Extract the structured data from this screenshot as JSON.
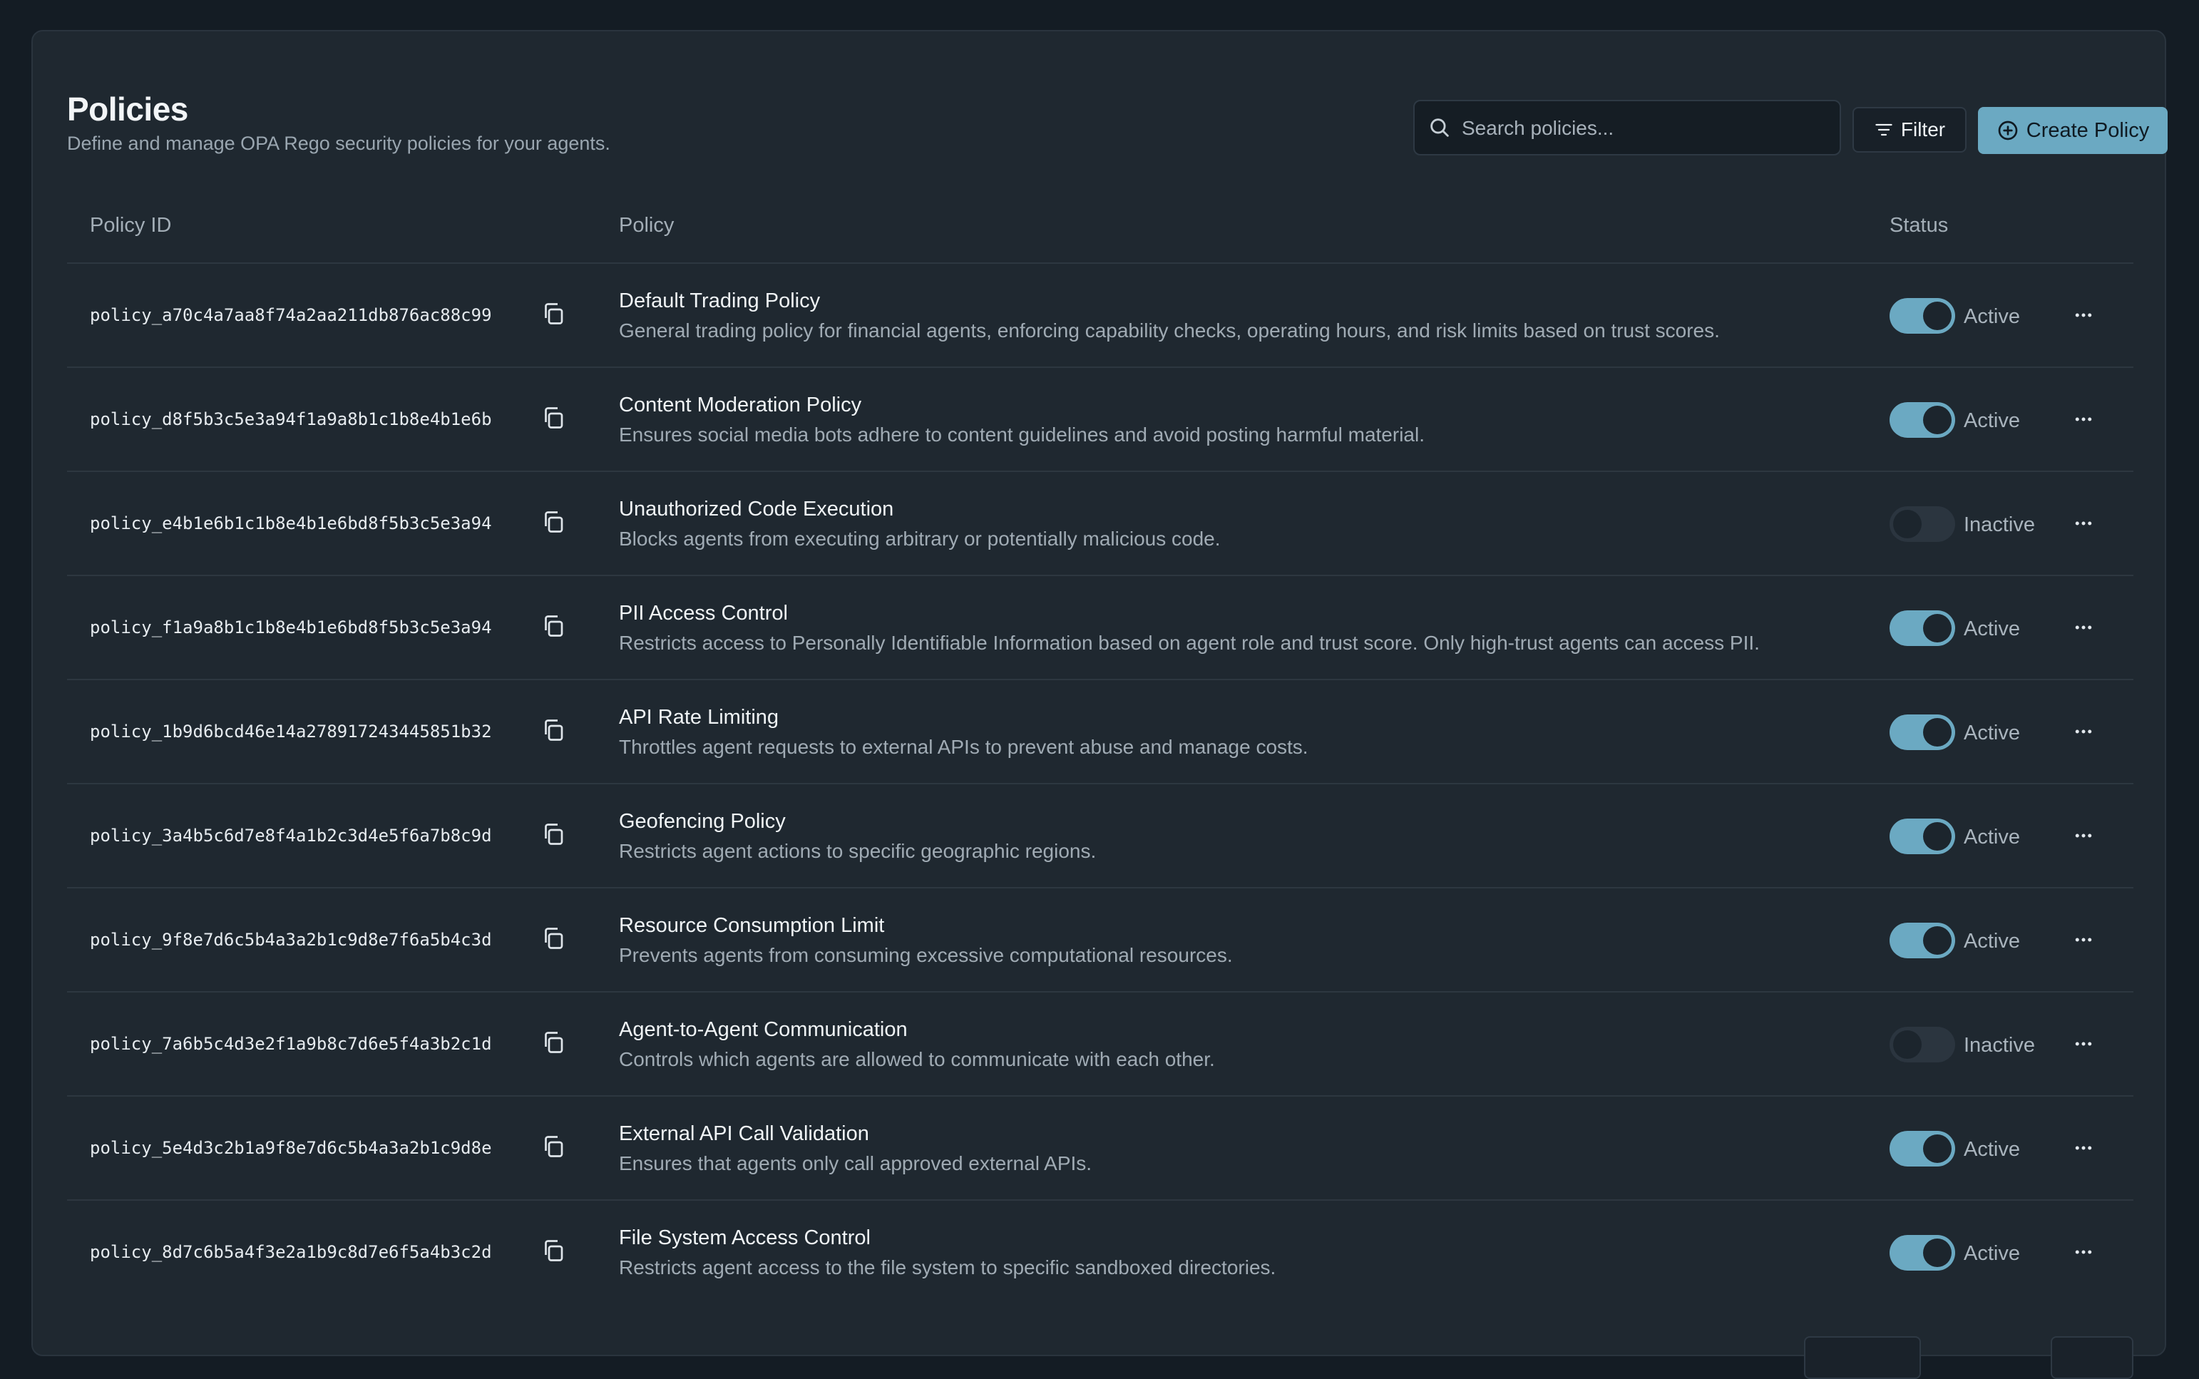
{
  "header": {
    "title": "Policies",
    "subtitle": "Define and manage OPA Rego security policies for your agents."
  },
  "search": {
    "placeholder": "Search policies...",
    "value": ""
  },
  "toolbar": {
    "filter_label": "Filter",
    "create_label": "Create Policy",
    "accent_color": "#6ba9c2"
  },
  "table": {
    "columns": [
      "Policy ID",
      "Policy",
      "Status"
    ],
    "rows": [
      {
        "id": "policy_a70c4a7aa8f74a2aa211db876ac88c99",
        "name": "Default Trading Policy",
        "description": "General trading policy for financial agents, enforcing capability checks, operating hours, and risk limits based on trust scores.",
        "enabled": true,
        "status": "Active"
      },
      {
        "id": "policy_d8f5b3c5e3a94f1a9a8b1c1b8e4b1e6b",
        "name": "Content Moderation Policy",
        "description": "Ensures social media bots adhere to content guidelines and avoid posting harmful material.",
        "enabled": true,
        "status": "Active"
      },
      {
        "id": "policy_e4b1e6b1c1b8e4b1e6bd8f5b3c5e3a94",
        "name": "Unauthorized Code Execution",
        "description": "Blocks agents from executing arbitrary or potentially malicious code.",
        "enabled": false,
        "status": "Inactive"
      },
      {
        "id": "policy_f1a9a8b1c1b8e4b1e6bd8f5b3c5e3a94",
        "name": "PII Access Control",
        "description": "Restricts access to Personally Identifiable Information based on agent role and trust score. Only high-trust agents can access PII.",
        "enabled": true,
        "status": "Active"
      },
      {
        "id": "policy_1b9d6bcd46e14a278917243445851b32",
        "name": "API Rate Limiting",
        "description": "Throttles agent requests to external APIs to prevent abuse and manage costs.",
        "enabled": true,
        "status": "Active"
      },
      {
        "id": "policy_3a4b5c6d7e8f4a1b2c3d4e5f6a7b8c9d",
        "name": "Geofencing Policy",
        "description": "Restricts agent actions to specific geographic regions.",
        "enabled": true,
        "status": "Active"
      },
      {
        "id": "policy_9f8e7d6c5b4a3a2b1c9d8e7f6a5b4c3d",
        "name": "Resource Consumption Limit",
        "description": "Prevents agents from consuming excessive computational resources.",
        "enabled": true,
        "status": "Active"
      },
      {
        "id": "policy_7a6b5c4d3e2f1a9b8c7d6e5f4a3b2c1d",
        "name": "Agent-to-Agent Communication",
        "description": "Controls which agents are allowed to communicate with each other.",
        "enabled": false,
        "status": "Inactive"
      },
      {
        "id": "policy_5e4d3c2b1a9f8e7d6c5b4a3a2b1c9d8e",
        "name": "External API Call Validation",
        "description": "Ensures that agents only call approved external APIs.",
        "enabled": true,
        "status": "Active"
      },
      {
        "id": "policy_8d7c6b5a4f3e2a1b9c8d7e6f5a4b3c2d",
        "name": "File System Access Control",
        "description": "Restricts agent access to the file system to specific sandboxed directories.",
        "enabled": true,
        "status": "Active"
      }
    ]
  },
  "icons": {
    "search": "search-icon",
    "filter": "filter-icon",
    "create": "plus-circle-icon",
    "copy": "copy-icon",
    "more": "more-horizontal-icon"
  }
}
